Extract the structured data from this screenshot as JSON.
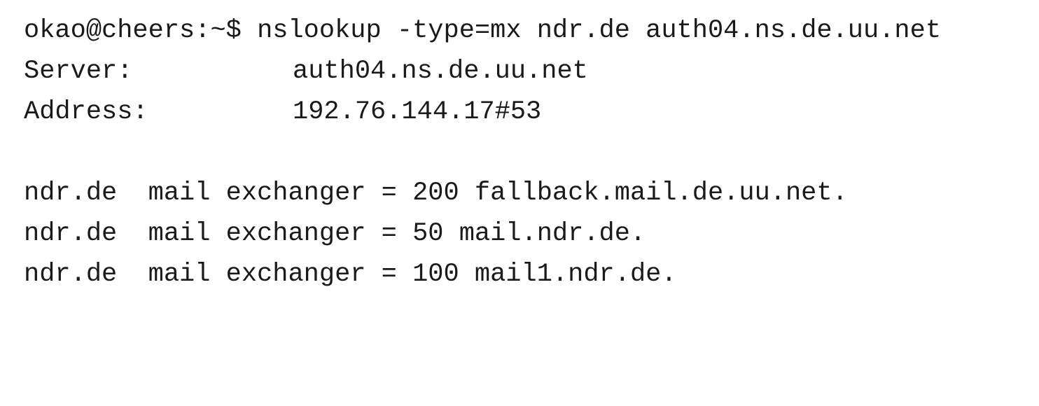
{
  "terminal": {
    "prompt": "okao@cheers:~$ ",
    "command": "nslookup -type=mx ndr.de auth04.ns.de.uu.net",
    "server": {
      "label": "Server:",
      "value": "auth04.ns.de.uu.net"
    },
    "address": {
      "label": "Address:",
      "value": "192.76.144.17#53"
    },
    "records": [
      {
        "text": "ndr.de  mail exchanger = 200 fallback.mail.de.uu.net."
      },
      {
        "text": "ndr.de  mail exchanger = 50 mail.ndr.de."
      },
      {
        "text": "ndr.de  mail exchanger = 100 mail1.ndr.de."
      }
    ]
  }
}
